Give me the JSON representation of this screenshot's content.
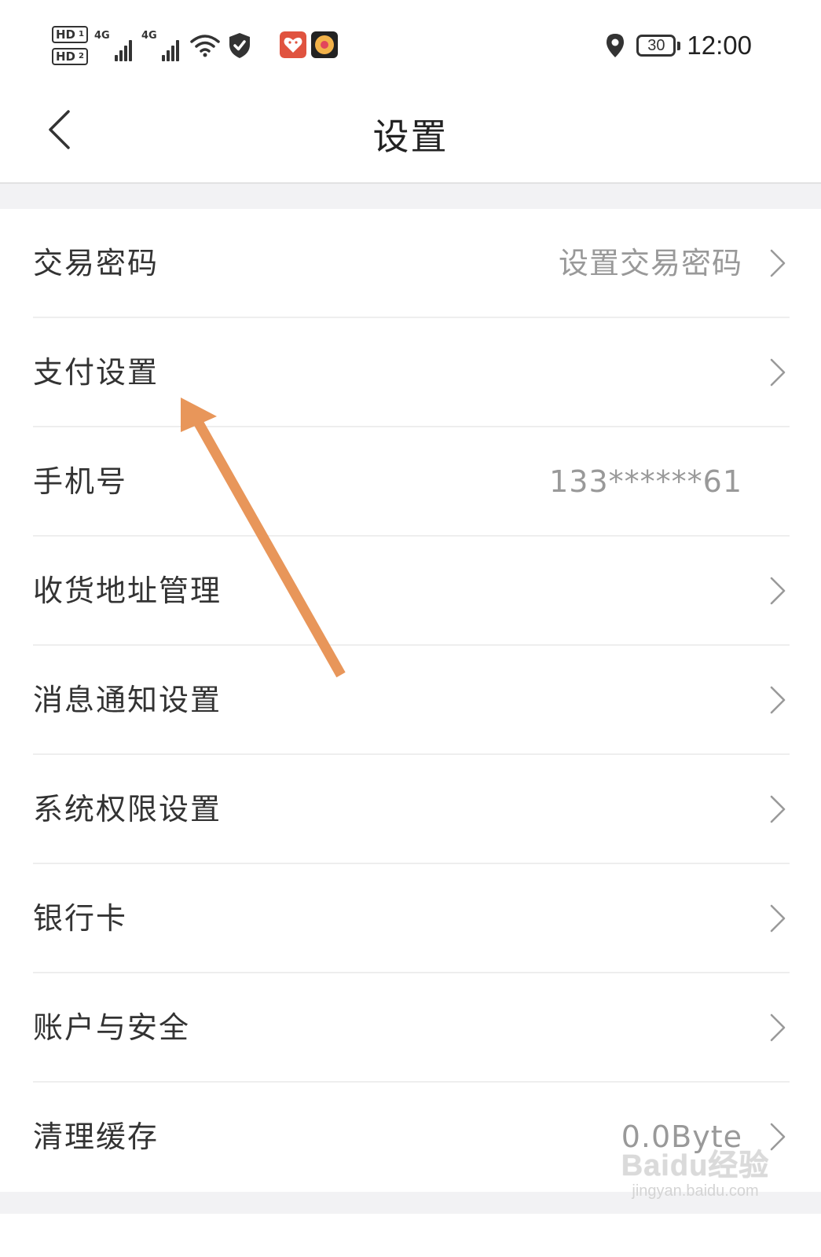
{
  "status_bar": {
    "hd1": "HD",
    "hd1_slot": "1",
    "hd2": "HD",
    "hd2_slot": "2",
    "network1": "4G",
    "network2": "4G",
    "battery": "30",
    "time": "12:00"
  },
  "header": {
    "title": "设置"
  },
  "settings": {
    "items": [
      {
        "label": "交易密码",
        "value": "设置交易密码",
        "chevron": true
      },
      {
        "label": "支付设置",
        "value": "",
        "chevron": true
      },
      {
        "label": "手机号",
        "value": "133******61",
        "chevron": false
      },
      {
        "label": "收货地址管理",
        "value": "",
        "chevron": true
      },
      {
        "label": "消息通知设置",
        "value": "",
        "chevron": true
      },
      {
        "label": "系统权限设置",
        "value": "",
        "chevron": true
      },
      {
        "label": "银行卡",
        "value": "",
        "chevron": true
      },
      {
        "label": "账户与安全",
        "value": "",
        "chevron": true
      },
      {
        "label": "清理缓存",
        "value": "0.0Byte",
        "chevron": true
      }
    ]
  },
  "annotation": {
    "color": "#e8965a",
    "points_to": "支付设置"
  },
  "watermark": {
    "brand": "Baidu经验",
    "url": "jingyan.baidu.com"
  },
  "colors": {
    "background": "#ffffff",
    "band": "#f2f2f4",
    "label_text": "#333333",
    "value_text": "#999999"
  }
}
